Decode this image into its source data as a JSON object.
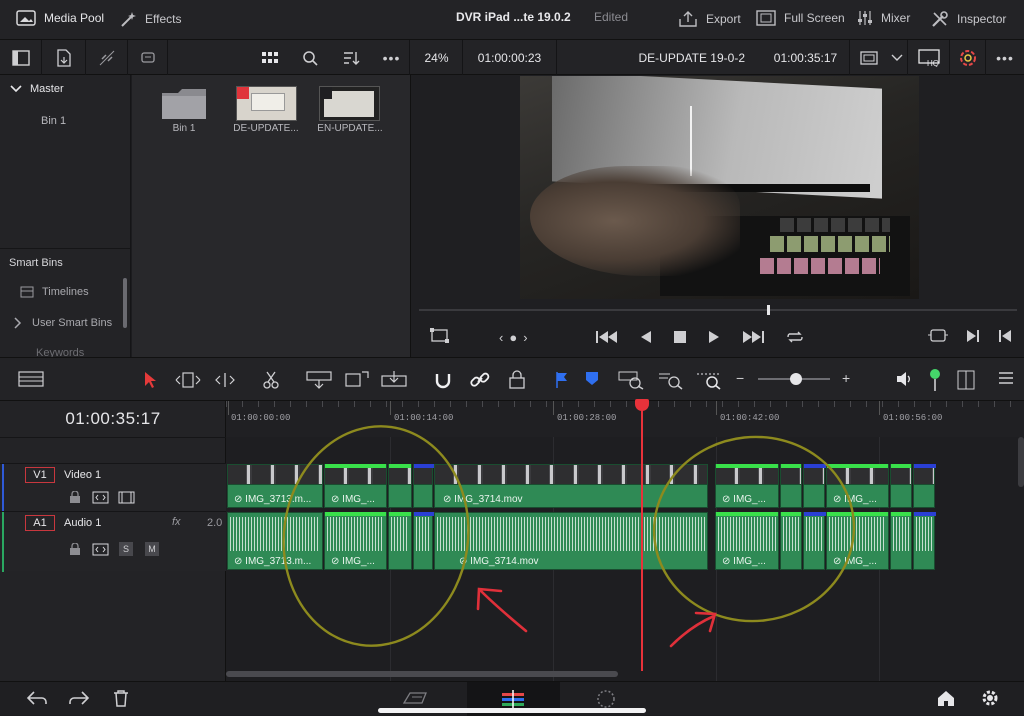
{
  "topbar": {
    "media_pool": "Media Pool",
    "effects": "Effects",
    "project_title": "DVR iPad ...te 19.0.2",
    "status": "Edited",
    "export": "Export",
    "full_screen": "Full Screen",
    "mixer": "Mixer",
    "inspector": "Inspector"
  },
  "toolbar2": {
    "zoom": "24%",
    "source_timecode": "01:00:00:23",
    "timeline_name": "DE-UPDATE 19-0-2",
    "record_timecode": "01:00:35:17"
  },
  "bins": {
    "master": "Master",
    "bin1": "Bin 1",
    "smart_bins": "Smart Bins",
    "timelines": "Timelines",
    "user_smart_bins": "User Smart Bins",
    "keywords": "Keywords"
  },
  "pool_items": [
    {
      "label": "Bin 1"
    },
    {
      "label": "DE-UPDATE..."
    },
    {
      "label": "EN-UPDATE..."
    }
  ],
  "timeline": {
    "timecode": "01:00:35:17",
    "ruler": [
      "01:00:00:00",
      "01:00:14:00",
      "01:00:28:00",
      "01:00:42:00",
      "01:00:56:00"
    ],
    "v1_tag": "V1",
    "v1_name": "Video 1",
    "a1_tag": "A1",
    "a1_name": "Audio 1",
    "fx": "fx",
    "level": "2.0",
    "solo": "S",
    "mute": "M"
  },
  "clips": {
    "c1": "IMG_3713.m...",
    "c2": "IMG_...",
    "c3": "IMG_3714.mov",
    "c4": "IMG_...",
    "c5": "IMG_..."
  },
  "colors": {
    "clip_green": "#2f8a55",
    "playhead": "#e8323a",
    "marker_blue": "#2a3fd4",
    "annotation_yellow": "#8d8a1e",
    "annotation_red": "#e0303a"
  }
}
